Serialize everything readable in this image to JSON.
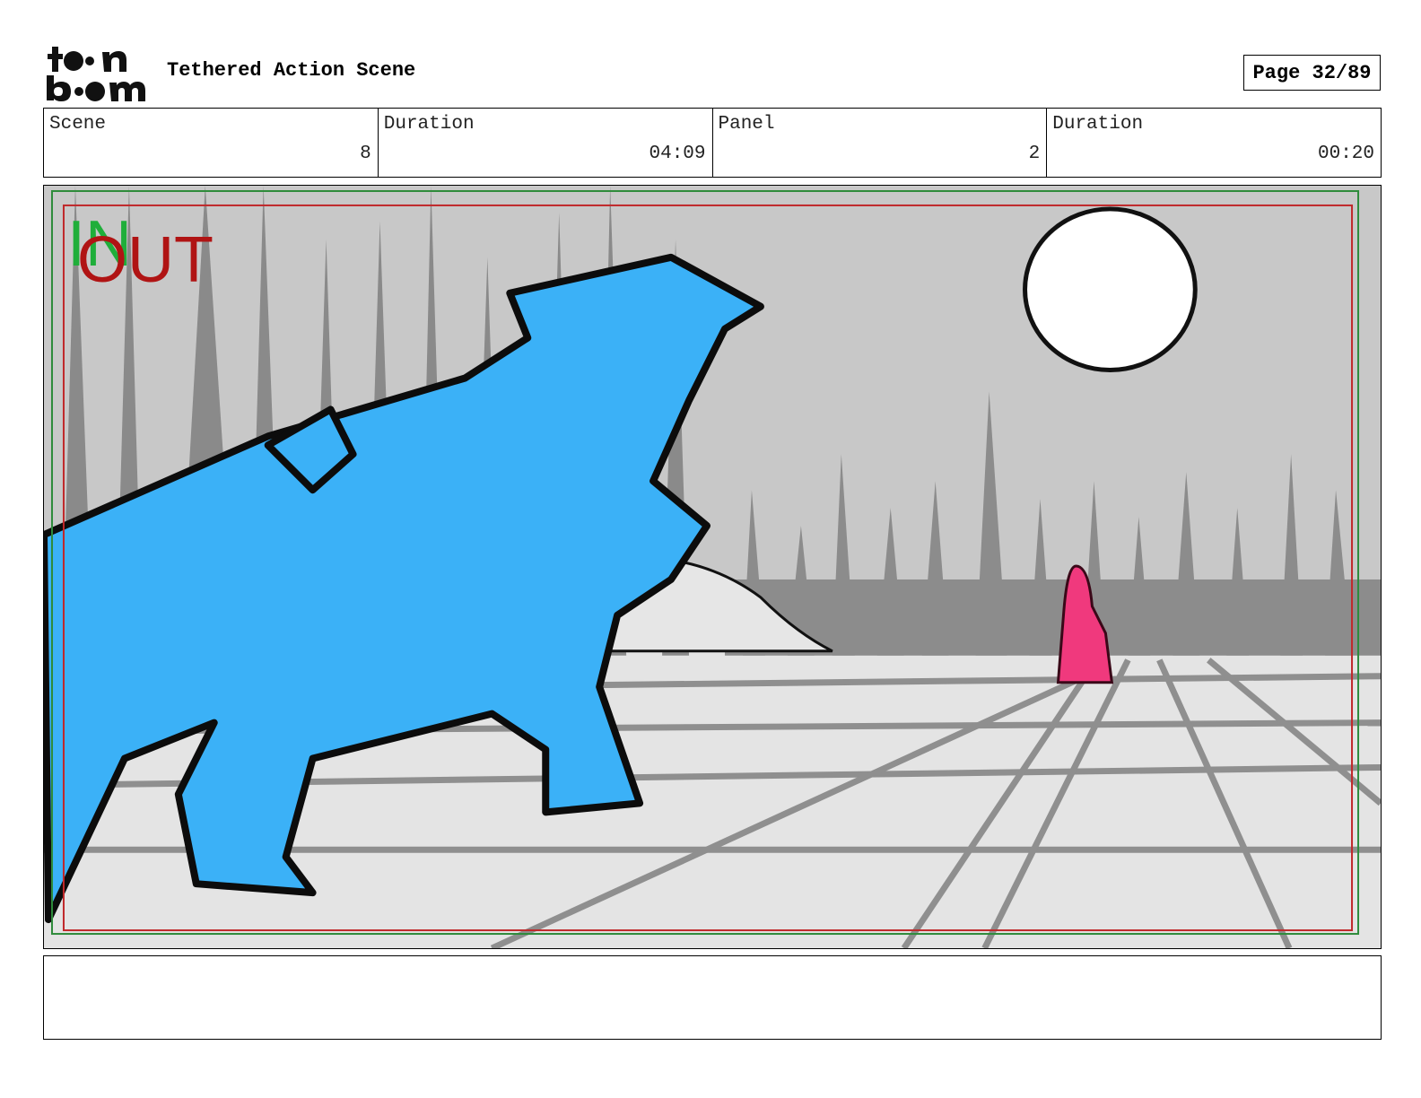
{
  "header": {
    "logo_text": "toon boom",
    "title": "Tethered Action Scene",
    "page_label": "Page 32/89"
  },
  "info": {
    "scene_label": "Scene",
    "scene_value": "8",
    "scene_duration_label": "Duration",
    "scene_duration_value": "04:09",
    "panel_label": "Panel",
    "panel_value": "2",
    "panel_duration_label": "Duration",
    "panel_duration_value": "00:20"
  },
  "panel": {
    "in_marker": "IN",
    "out_marker": "OUT",
    "colors": {
      "character": "#3bb1f7",
      "figure": "#f0397d",
      "sky": "#c8c8c8",
      "ground": "#e4e4e4",
      "trees": "#8c8c8c",
      "safe_frame_green": "#2e8b3a",
      "safe_frame_red": "#c0282a"
    }
  },
  "notes": {
    "text": ""
  }
}
